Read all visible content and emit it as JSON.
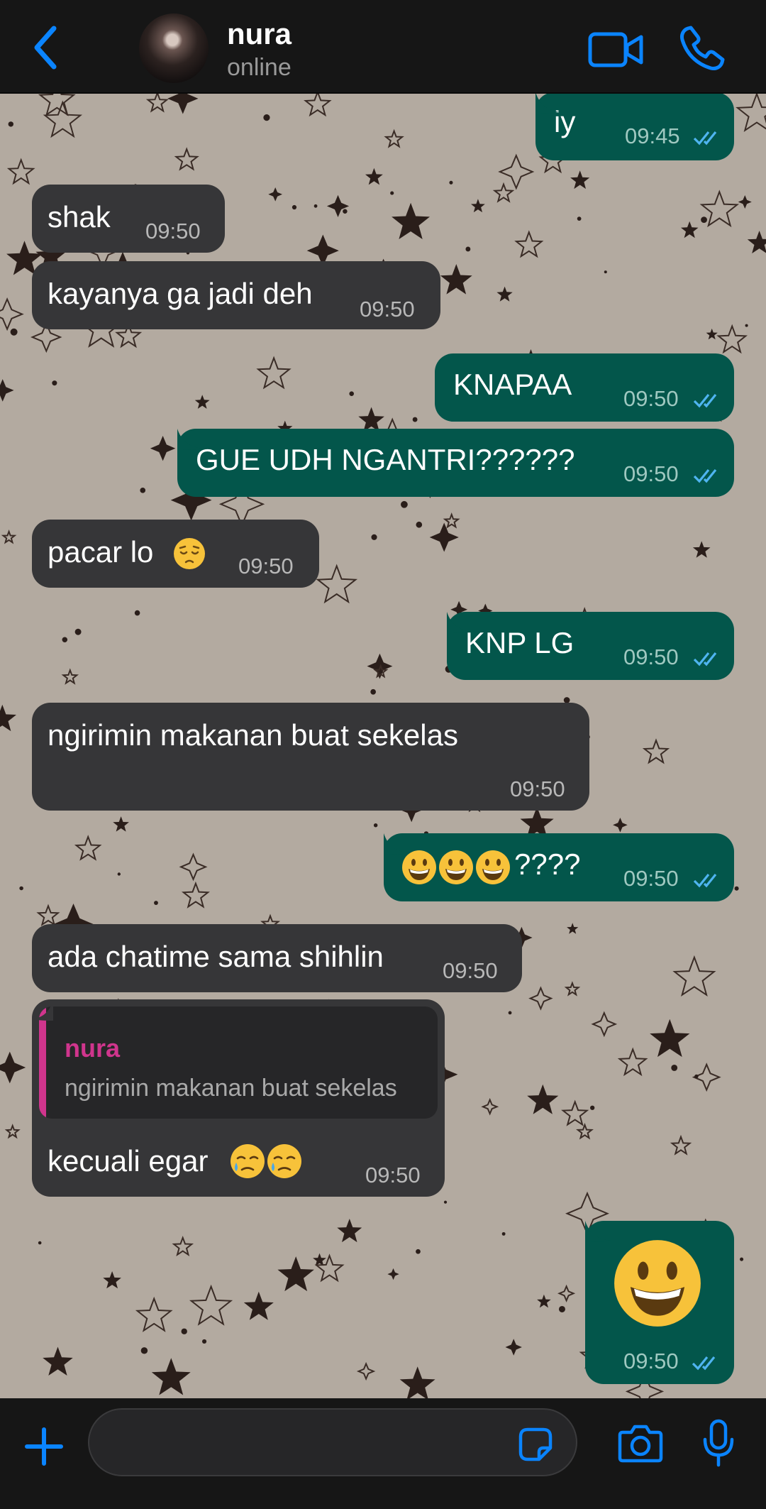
{
  "header": {
    "contact_name": "nura",
    "contact_status": "online",
    "icons": [
      "back-chevron-icon",
      "video-call-icon",
      "phone-call-icon"
    ],
    "accent_color": "#0a84ff"
  },
  "messages": [
    {
      "dir": "out",
      "text": "iy",
      "time": "09:45",
      "read": true
    },
    {
      "dir": "in",
      "text": "shak",
      "time": "09:50"
    },
    {
      "dir": "in",
      "text": "kayanya ga jadi deh",
      "time": "09:50"
    },
    {
      "dir": "out",
      "text": "KNAPAA",
      "time": "09:50",
      "read": true
    },
    {
      "dir": "out",
      "text": "GUE UDH NGANTRI??????",
      "time": "09:50",
      "read": true
    },
    {
      "dir": "in",
      "text": "pacar lo",
      "emoji": "pensive-face",
      "time": "09:50"
    },
    {
      "dir": "out",
      "text": "KNP LG",
      "time": "09:50",
      "read": true
    },
    {
      "dir": "in",
      "text": "ngirimin makanan buat sekelas",
      "time": "09:50"
    },
    {
      "dir": "out",
      "emoji_prefix": [
        "grinning-face",
        "grinning-face",
        "grinning-face"
      ],
      "text": "????",
      "time": "09:50",
      "read": true
    },
    {
      "dir": "in",
      "text": "ada chatime sama shihlin",
      "time": "09:50"
    },
    {
      "dir": "in",
      "reply_to": {
        "author": "nura",
        "text": "ngirimin makanan buat sekelas"
      },
      "text": "kecuali egar",
      "emoji_suffix": [
        "face-holding-back-tears",
        "face-holding-back-tears"
      ],
      "time": "09:50"
    },
    {
      "dir": "out",
      "big_emoji": "grinning-face",
      "time": "09:50",
      "read": true
    }
  ],
  "composer": {
    "value": "",
    "icons": [
      "plus-icon",
      "sticker-icon",
      "camera-icon",
      "microphone-icon"
    ]
  },
  "colors": {
    "incoming_bubble": "#363638",
    "outgoing_bubble": "#03564b",
    "reply_accent": "#d0358d",
    "read_tick": "#4fb4f0"
  }
}
